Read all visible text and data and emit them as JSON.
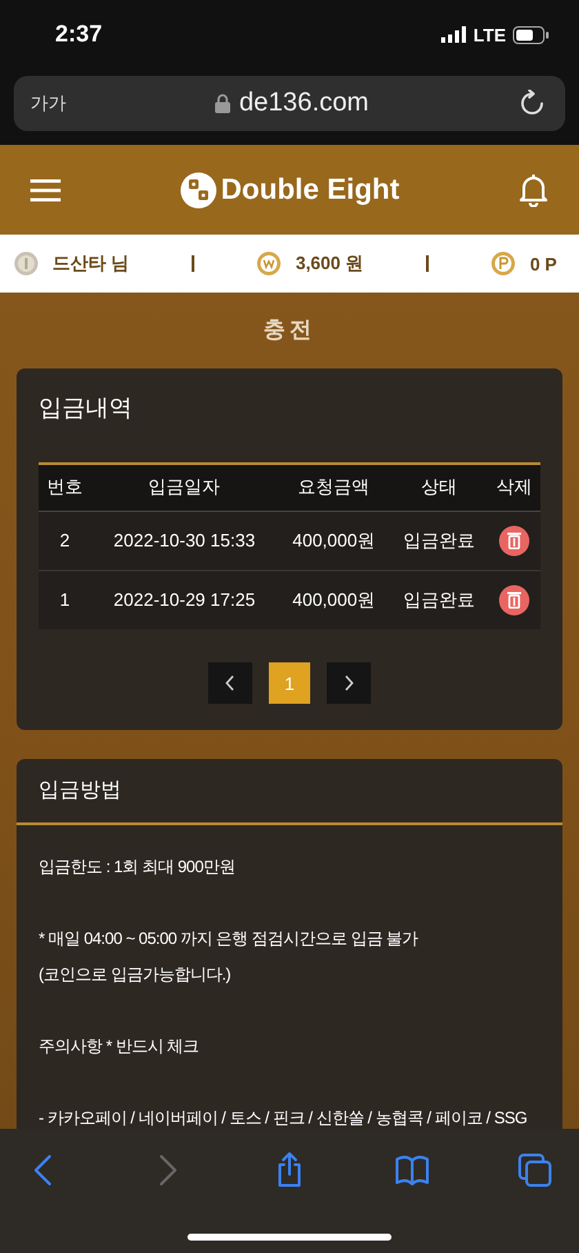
{
  "status_bar": {
    "time": "2:37",
    "network": "LTE"
  },
  "browser": {
    "text_size": "가가",
    "url": "de136.com"
  },
  "header": {
    "title": "Double Eight"
  },
  "account": {
    "user": "드산타 님",
    "balance": "3,600 원",
    "points": "0 P"
  },
  "page_title": "충전",
  "deposit_history": {
    "title": "입금내역",
    "columns": [
      "번호",
      "입금일자",
      "요청금액",
      "상태",
      "삭제"
    ],
    "rows": [
      {
        "no": "2",
        "date": "2022-10-30 15:33",
        "amount": "400,000원",
        "status": "입금완료"
      },
      {
        "no": "1",
        "date": "2022-10-29 17:25",
        "amount": "400,000원",
        "status": "입금완료"
      }
    ],
    "pages": [
      {
        "label": "1",
        "selected": true
      }
    ]
  },
  "deposit_method": {
    "title": "입금방법",
    "paragraphs": [
      [
        "입금한도 : 1회 최대 900만원"
      ],
      [
        "* 매일 04:00 ~ 05:00 까지 은행 점검시간으로 입금 불가",
        "(코인으로 입금가능합니다.)"
      ],
      [
        "주의사항 * 반드시 체크"
      ],
      [
        "- 카카오페이 / 네이버페이 / 토스 / 핀크 / 신한쏠 / 농협콕 / 페이코 / SSG"
      ]
    ]
  },
  "toolbar": [
    {
      "kind": "back",
      "disabled": false
    },
    {
      "kind": "forward",
      "disabled": true
    },
    {
      "kind": "share",
      "disabled": false
    },
    {
      "kind": "bookmarks",
      "disabled": false
    },
    {
      "kind": "tabs",
      "disabled": false
    }
  ]
}
